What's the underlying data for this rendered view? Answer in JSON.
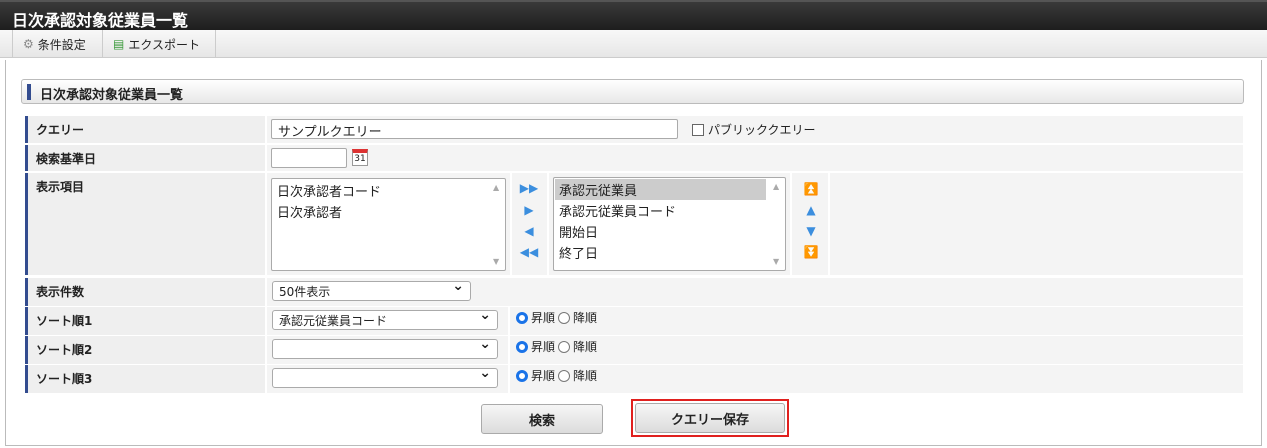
{
  "title": "日次承認対象従業員一覧",
  "toolbar": {
    "conditions": "条件設定",
    "export": "エクスポート"
  },
  "section": "日次承認対象従業員一覧",
  "form": {
    "query_label": "クエリー",
    "query_value": "サンプルクエリー",
    "public_query": "パブリッククエリー",
    "base_date_label": "検索基準日",
    "base_date_value": "",
    "display_items_label": "表示項目",
    "available_items": [
      "日次承認者コード",
      "日次承認者"
    ],
    "selected_items": [
      "承認元従業員",
      "承認元従業員コード",
      "開始日",
      "終了日"
    ],
    "count_label": "表示件数",
    "count_value": "50件表示",
    "sorts": [
      {
        "label": "ソート順1",
        "value": "承認元従業員コード",
        "asc": "昇順",
        "desc": "降順",
        "order": "asc"
      },
      {
        "label": "ソート順2",
        "value": "",
        "asc": "昇順",
        "desc": "降順",
        "order": "asc"
      },
      {
        "label": "ソート順3",
        "value": "",
        "asc": "昇順",
        "desc": "降順",
        "order": "asc"
      }
    ]
  },
  "buttons": {
    "search": "検索",
    "save_query": "クエリー保存"
  },
  "colors": {
    "accent": "#334c8f",
    "highlight": "#e0201e"
  }
}
